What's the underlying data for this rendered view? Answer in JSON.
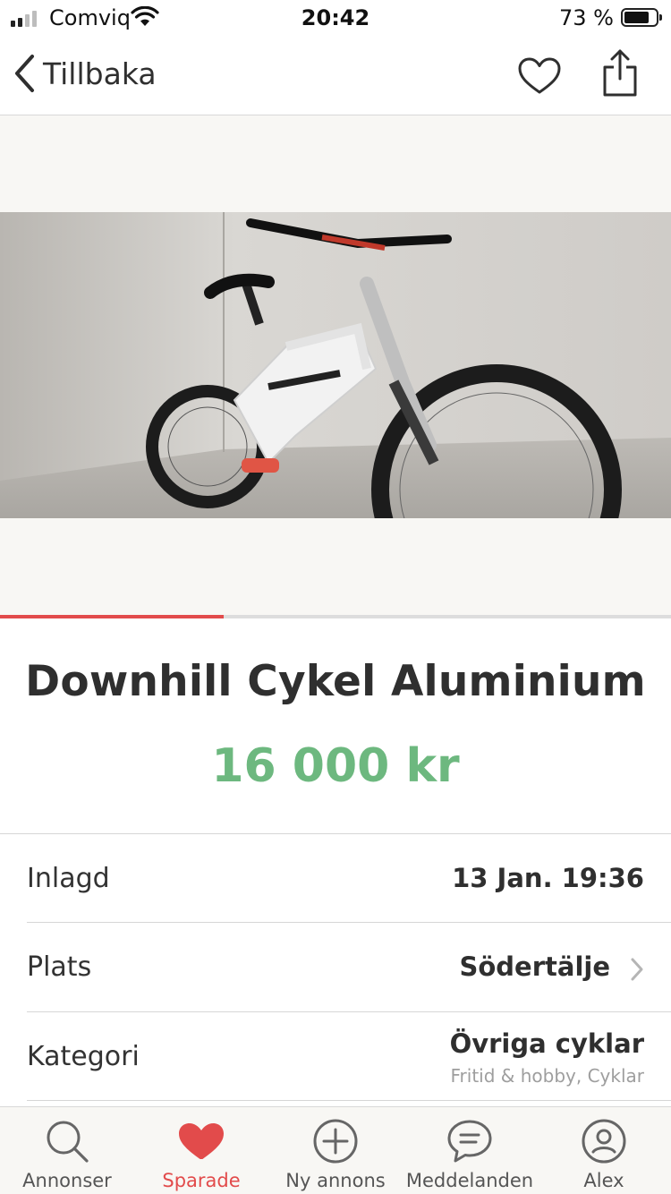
{
  "status_bar": {
    "carrier": "Comviq",
    "time": "20:42",
    "battery": "73 %"
  },
  "nav": {
    "back_label": "Tillbaka",
    "favorite_icon": "heart-outline-icon",
    "share_icon": "share-icon"
  },
  "gallery": {
    "image_alt": "bike-photo",
    "progress_fraction": 0.333
  },
  "listing": {
    "title": "Downhill Cykel Aluminium",
    "price": "16 000 kr"
  },
  "details": [
    {
      "key": "Inlagd",
      "value": "13 Jan. 19:36"
    },
    {
      "key": "Plats",
      "value": "Södertälje"
    },
    {
      "key": "Kategori",
      "value": "Övriga cyklar",
      "sub": "Fritid & hobby, Cyklar"
    }
  ],
  "tabs": [
    {
      "label": "Annonser",
      "icon": "search-icon"
    },
    {
      "label": "Sparade",
      "icon": "heart-icon",
      "active": true
    },
    {
      "label": "Ny annons",
      "icon": "plus-circle-icon"
    },
    {
      "label": "Meddelanden",
      "icon": "chat-icon"
    },
    {
      "label": "Alex",
      "icon": "profile-icon"
    }
  ],
  "colors": {
    "accent": "#e24b4b",
    "price": "#6db87f",
    "text": "#2f2f2f"
  }
}
